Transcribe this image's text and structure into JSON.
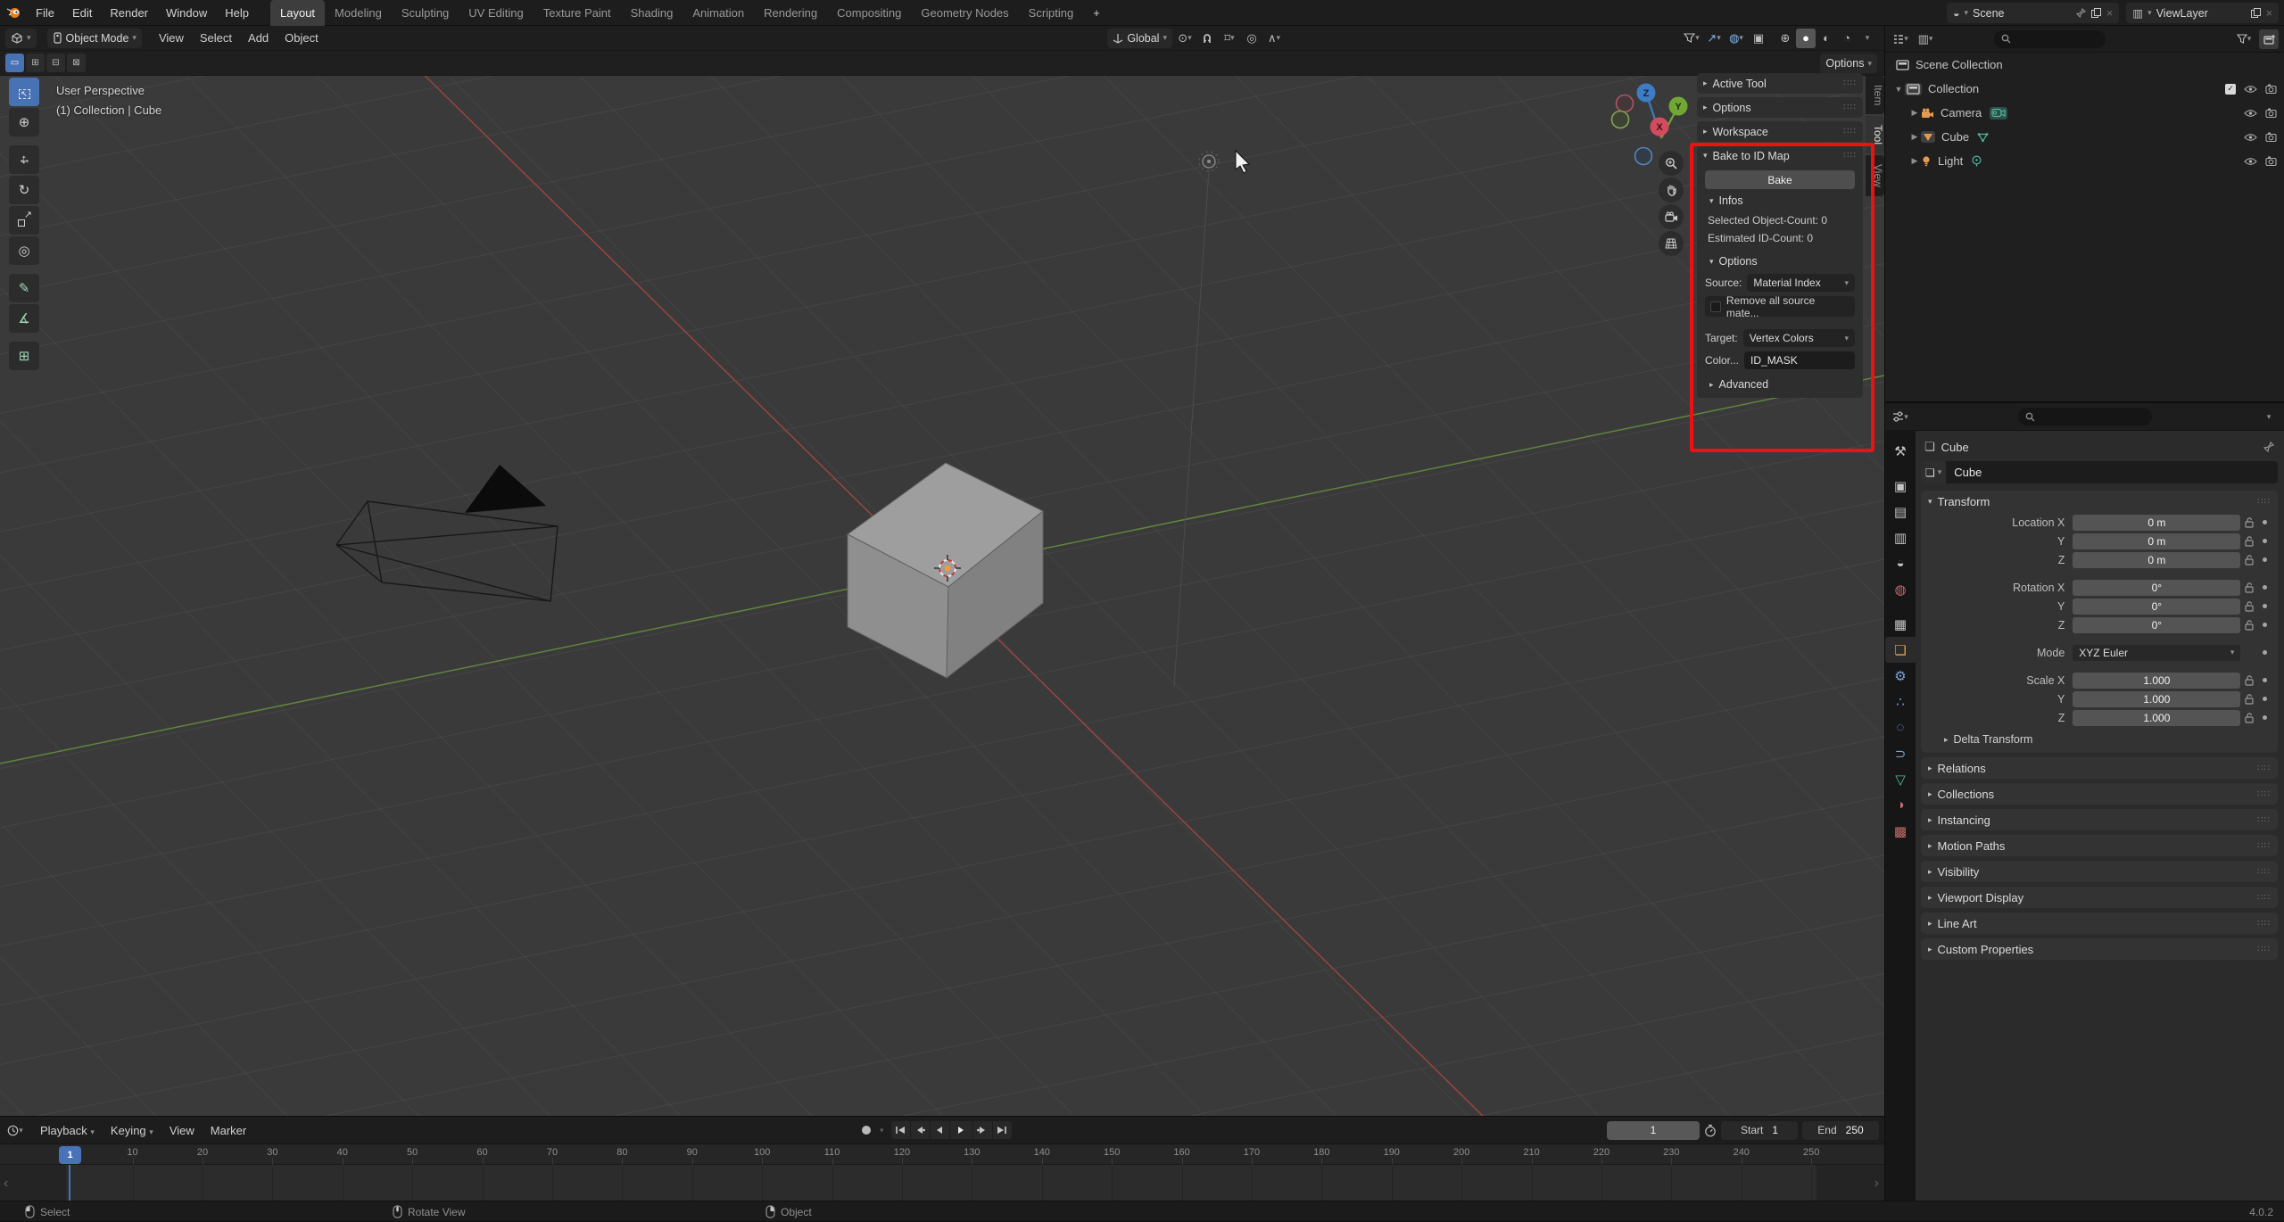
{
  "colors": {
    "accent": "#4772b3",
    "annotation_red": "#ee1111",
    "object_orange": "#e39a50",
    "data_green": "#4fb8a0",
    "playhead_blue": "#4a72b8"
  },
  "topbar": {
    "menus": [
      "File",
      "Edit",
      "Render",
      "Window",
      "Help"
    ],
    "workspaces": [
      "Layout",
      "Modeling",
      "Sculpting",
      "UV Editing",
      "Texture Paint",
      "Shading",
      "Animation",
      "Rendering",
      "Compositing",
      "Geometry Nodes",
      "Scripting"
    ],
    "active_workspace": "Layout",
    "new_workspace_label": "+",
    "scene_name": "Scene",
    "viewlayer_name": "ViewLayer"
  },
  "viewport": {
    "header": {
      "mode": "Object Mode",
      "menus": [
        "View",
        "Select",
        "Add",
        "Object"
      ],
      "orientation": "Global",
      "options_label": "Options"
    },
    "info_line1": "User Perspective",
    "info_line2": "(1) Collection | Cube",
    "axis_labels": {
      "x": "X",
      "y": "Y",
      "z": "Z"
    },
    "tools": [
      {
        "name": "select-box",
        "active": true
      },
      {
        "name": "cursor"
      },
      {
        "name": "move",
        "group": true
      },
      {
        "name": "rotate"
      },
      {
        "name": "scale"
      },
      {
        "name": "transform"
      },
      {
        "name": "annotate",
        "group": true
      },
      {
        "name": "measure"
      },
      {
        "name": "add-cube",
        "group": true
      }
    ],
    "sidebar_tabs": [
      {
        "label": "Item"
      },
      {
        "label": "Tool",
        "active": true
      },
      {
        "label": "View"
      }
    ]
  },
  "npanel": {
    "collapsed_panels": [
      "Active Tool",
      "Options",
      "Workspace"
    ],
    "bake": {
      "title": "Bake to ID Map",
      "bake_button": "Bake",
      "infos_title": "Infos",
      "info_lines": [
        "Selected Object-Count: 0",
        "Estimated ID-Count: 0"
      ],
      "options_title": "Options",
      "source_label": "Source:",
      "source_value": "Material Index",
      "remove_label": "Remove all source mate...",
      "target_label": "Target:",
      "target_value": "Vertex Colors",
      "color_label": "Color...",
      "color_value": "ID_MASK",
      "advanced_label": "Advanced"
    }
  },
  "outliner": {
    "root_label": "Scene Collection",
    "collection_label": "Collection",
    "items": [
      {
        "name": "Camera",
        "icon": "camera"
      },
      {
        "name": "Cube",
        "icon": "mesh"
      },
      {
        "name": "Light",
        "icon": "light"
      }
    ]
  },
  "properties": {
    "tabs": [
      {
        "name": "tool"
      },
      {
        "name": "render"
      },
      {
        "name": "output"
      },
      {
        "name": "view-layer"
      },
      {
        "name": "scene"
      },
      {
        "name": "world"
      },
      {
        "name": "collection"
      },
      {
        "name": "object",
        "active": true
      },
      {
        "name": "modifiers"
      },
      {
        "name": "particles"
      },
      {
        "name": "physics"
      },
      {
        "name": "constraints"
      },
      {
        "name": "data"
      },
      {
        "name": "material"
      },
      {
        "name": "texture"
      }
    ],
    "breadcrumb": "Cube",
    "object_name": "Cube",
    "transform": {
      "title": "Transform",
      "location": [
        {
          "label": "Location X",
          "value": "0 m"
        },
        {
          "label": "Y",
          "value": "0 m"
        },
        {
          "label": "Z",
          "value": "0 m"
        }
      ],
      "rotation": [
        {
          "label": "Rotation X",
          "value": "0°"
        },
        {
          "label": "Y",
          "value": "0°"
        },
        {
          "label": "Z",
          "value": "0°"
        }
      ],
      "mode_label": "Mode",
      "mode_value": "XYZ Euler",
      "scale": [
        {
          "label": "Scale X",
          "value": "1.000"
        },
        {
          "label": "Y",
          "value": "1.000"
        },
        {
          "label": "Z",
          "value": "1.000"
        }
      ],
      "delta_label": "Delta Transform"
    },
    "panels": [
      "Relations",
      "Collections",
      "Instancing",
      "Motion Paths",
      "Visibility",
      "Viewport Display",
      "Line Art",
      "Custom Properties"
    ]
  },
  "timeline": {
    "menus": [
      "Playback",
      "Keying",
      "View",
      "Marker"
    ],
    "current_frame": "1",
    "playhead_label": "1",
    "start_label": "Start",
    "start_value": "1",
    "end_label": "End",
    "end_value": "250",
    "ticks": [
      10,
      20,
      30,
      40,
      50,
      60,
      70,
      80,
      90,
      100,
      110,
      120,
      130,
      140,
      150,
      160,
      170,
      180,
      190,
      200,
      210,
      220,
      230,
      240,
      250
    ]
  },
  "statusbar": {
    "items": [
      {
        "icon": "mouse-left",
        "label": "Select"
      },
      {
        "icon": "mouse-middle",
        "label": "Rotate View"
      },
      {
        "icon": "mouse-right",
        "label": "Object"
      }
    ],
    "version": "4.0.2"
  }
}
